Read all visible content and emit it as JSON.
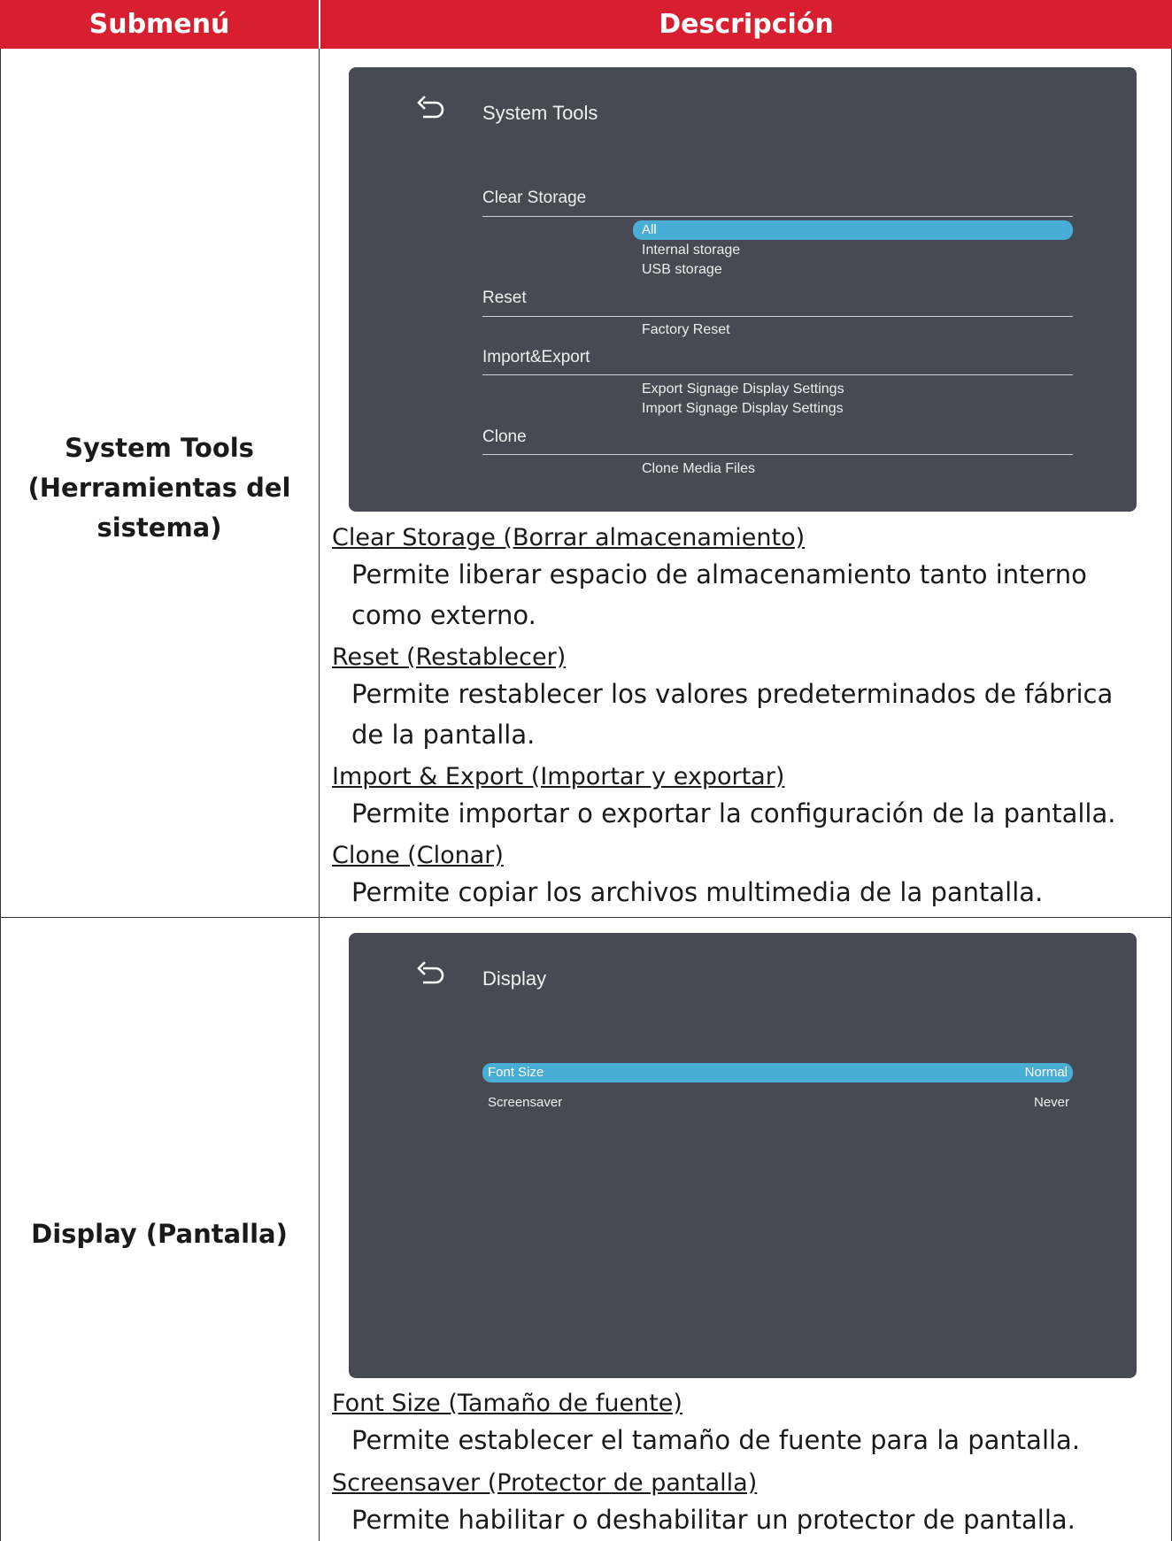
{
  "header": {
    "col1": "Submenú",
    "col2": "Descripción"
  },
  "rows": [
    {
      "label_lines": [
        "System Tools",
        "(Herramientas del",
        "sistema)"
      ],
      "screen": {
        "title": "System Tools",
        "sections": [
          {
            "name": "Clear Storage",
            "options": [
              "All",
              "Internal storage",
              "USB storage"
            ],
            "selected": "All"
          },
          {
            "name": "Reset",
            "options": [
              "Factory Reset"
            ]
          },
          {
            "name": "Import&Export",
            "options": [
              "Export Signage Display Settings",
              "Import Signage Display Settings"
            ]
          },
          {
            "name": "Clone",
            "options": [
              "Clone Media Files"
            ]
          }
        ]
      },
      "items": [
        {
          "title": "Clear Storage (Borrar almacenamiento)",
          "desc": "Permite liberar espacio de almacenamiento tanto interno como externo."
        },
        {
          "title": "Reset (Restablecer)",
          "desc": "Permite restablecer los valores predeterminados de fábrica de la pantalla."
        },
        {
          "title": "Import & Export (Importar y exportar)",
          "desc": "Permite importar o exportar la configuración de la pantalla."
        },
        {
          "title": "Clone (Clonar)",
          "desc": "Permite copiar los archivos multimedia de la pantalla."
        }
      ]
    },
    {
      "label_lines": [
        "Display (Pantalla)"
      ],
      "screen": {
        "title": "Display",
        "settings": [
          {
            "name": "Font Size",
            "value": "Normal",
            "selected": true
          },
          {
            "name": "Screensaver",
            "value": "Never"
          }
        ]
      },
      "items": [
        {
          "title": "Font Size (Tamaño de fuente)",
          "desc": "Permite establecer el tamaño de fuente para la pantalla."
        },
        {
          "title": "Screensaver (Protector de pantalla)",
          "desc": "Permite habilitar o deshabilitar un protector de pantalla."
        }
      ]
    }
  ],
  "colors": {
    "header_bg": "#d71f2f",
    "screen_bg": "#474a53",
    "highlight": "#48aed6"
  }
}
